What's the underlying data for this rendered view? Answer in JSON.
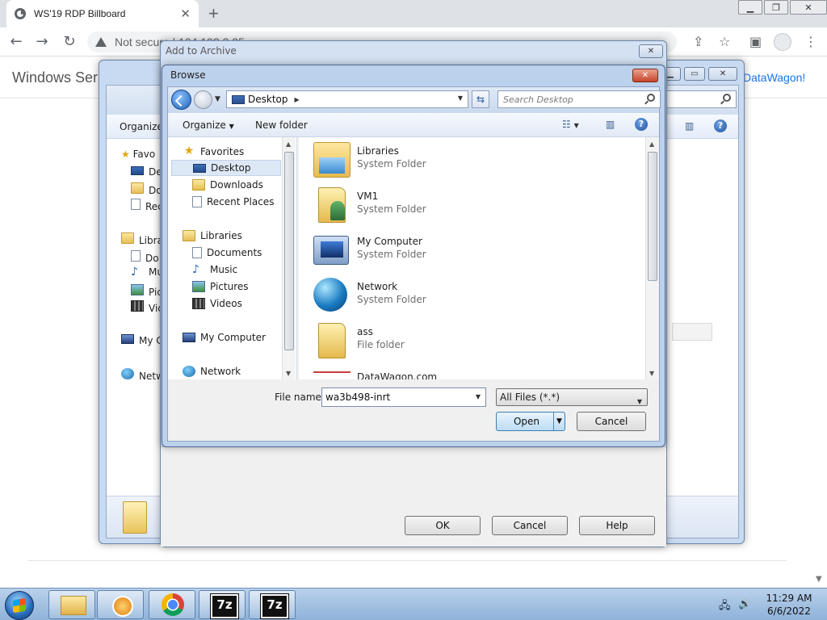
{
  "chrome": {
    "tab_title": "WS'19 RDP Billboard",
    "tab_close": "✕",
    "new_tab": "+",
    "omnibox_text": "Not secure | 104.192.3.35"
  },
  "page": {
    "title": "Windows Ser",
    "link_text": "DataWagon!"
  },
  "bg_window": {
    "organize_label": "Organize",
    "sidebar": [
      "Favo",
      "Des",
      "Dov",
      "Rec",
      "Libra",
      "Do",
      "Mu",
      "Pic",
      "Vid",
      "My C",
      "Netw"
    ]
  },
  "archive_dialog": {
    "title": "Add to Archive",
    "ok_label": "OK",
    "cancel_label": "Cancel",
    "help_label": "Help"
  },
  "browse_dialog": {
    "title": "Browse",
    "address": "Desktop",
    "search_placeholder": "Search Desktop",
    "organize_label": "Organize",
    "new_folder_label": "New folder",
    "help_glyph": "?",
    "nav_items": [
      {
        "label": "Favorites",
        "icon": "star-icon"
      },
      {
        "label": "Desktop",
        "icon": "desktop-icon",
        "selected": true
      },
      {
        "label": "Downloads",
        "icon": "folder-icon"
      },
      {
        "label": "Recent Places",
        "icon": "recent-icon"
      },
      {
        "label": "Libraries",
        "icon": "library-icon"
      },
      {
        "label": "Documents",
        "icon": "document-icon"
      },
      {
        "label": "Music",
        "icon": "music-icon"
      },
      {
        "label": "Pictures",
        "icon": "picture-icon"
      },
      {
        "label": "Videos",
        "icon": "video-icon"
      },
      {
        "label": "My Computer",
        "icon": "computer-icon"
      },
      {
        "label": "Network",
        "icon": "network-icon"
      }
    ],
    "files": [
      {
        "name": "Libraries",
        "type": "System Folder"
      },
      {
        "name": "VM1",
        "type": "System Folder"
      },
      {
        "name": "My Computer",
        "type": "System Folder"
      },
      {
        "name": "Network",
        "type": "System Folder"
      },
      {
        "name": "ass",
        "type": "File folder"
      },
      {
        "name": "DataWagon.com",
        "type": ""
      }
    ],
    "file_name_label": "File name:",
    "file_name_value": "wa3b498-inrt",
    "file_type_value": "All Files (*.*)",
    "open_label": "Open",
    "cancel_label": "Cancel"
  },
  "taskbar": {
    "time": "11:29 AM",
    "date": "6/6/2022"
  }
}
